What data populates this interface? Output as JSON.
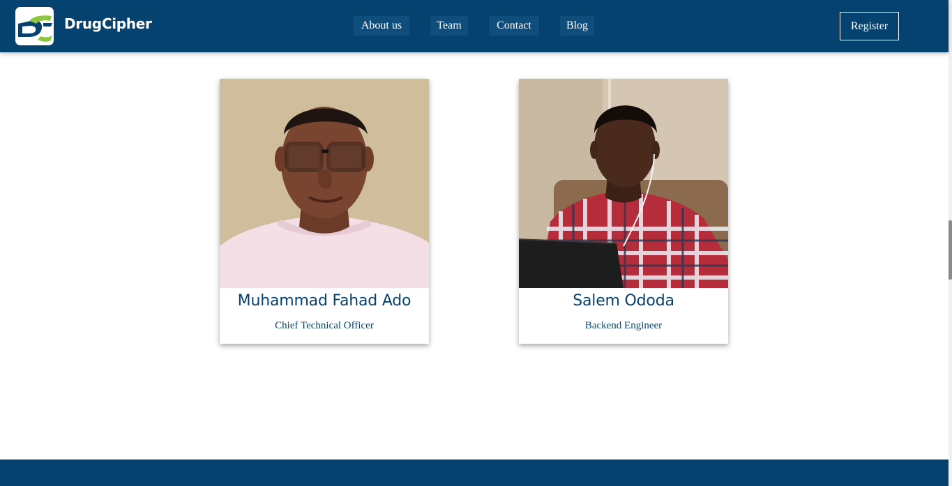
{
  "header": {
    "brand": "DrugCipher",
    "logo_icon": "drugcipher-logo-icon",
    "nav": [
      {
        "label": "About us"
      },
      {
        "label": "Team"
      },
      {
        "label": "Contact"
      },
      {
        "label": "Blog"
      }
    ],
    "register_label": "Register"
  },
  "team": [
    {
      "name": "Muhammad Fahad Ado",
      "role": "Chief Technical Officer"
    },
    {
      "name": "Salem Ododa",
      "role": "Backend Engineer"
    }
  ],
  "colors": {
    "primary": "#06426f",
    "nav_button_bg": "#0f4d7c",
    "logo_green": "#8dc63f",
    "logo_navy": "#06426f",
    "background": "#ffffff"
  }
}
